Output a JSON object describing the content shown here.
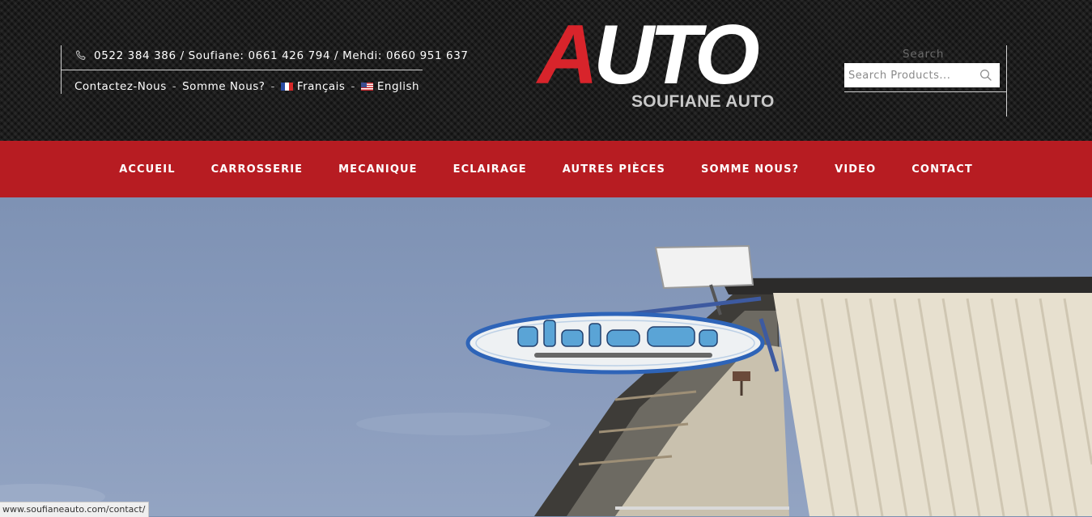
{
  "header": {
    "phone_line": "0522 384 386 / Soufiane: 0661 426 794 / Mehdi: 0660 951 637",
    "links": {
      "contact": "Contactez-Nous",
      "about": "Somme Nous?",
      "lang_fr": "Français",
      "lang_en": "English",
      "separator": "-"
    },
    "logo": {
      "word_first": "A",
      "word_rest": "UTO",
      "subtitle": "SOUFIANE AUTO"
    },
    "search": {
      "label": "Search",
      "placeholder": "Search Products..."
    }
  },
  "nav": {
    "items": [
      "ACCUEIL",
      "CARROSSERIE",
      "MECANIQUE",
      "ECLAIRAGE",
      "AUTRES PIÈCES",
      "SOMME NOUS?",
      "VIDEO",
      "CONTACT"
    ]
  },
  "status_bar": {
    "url": "www.soufianeauto.com/contact/"
  },
  "colors": {
    "brand_red": "#b71c22",
    "logo_red": "#d8242b",
    "header_dark": "#1c1c1c"
  },
  "icons": [
    "phone-icon",
    "flag-fr-icon",
    "flag-us-icon",
    "search-icon"
  ]
}
